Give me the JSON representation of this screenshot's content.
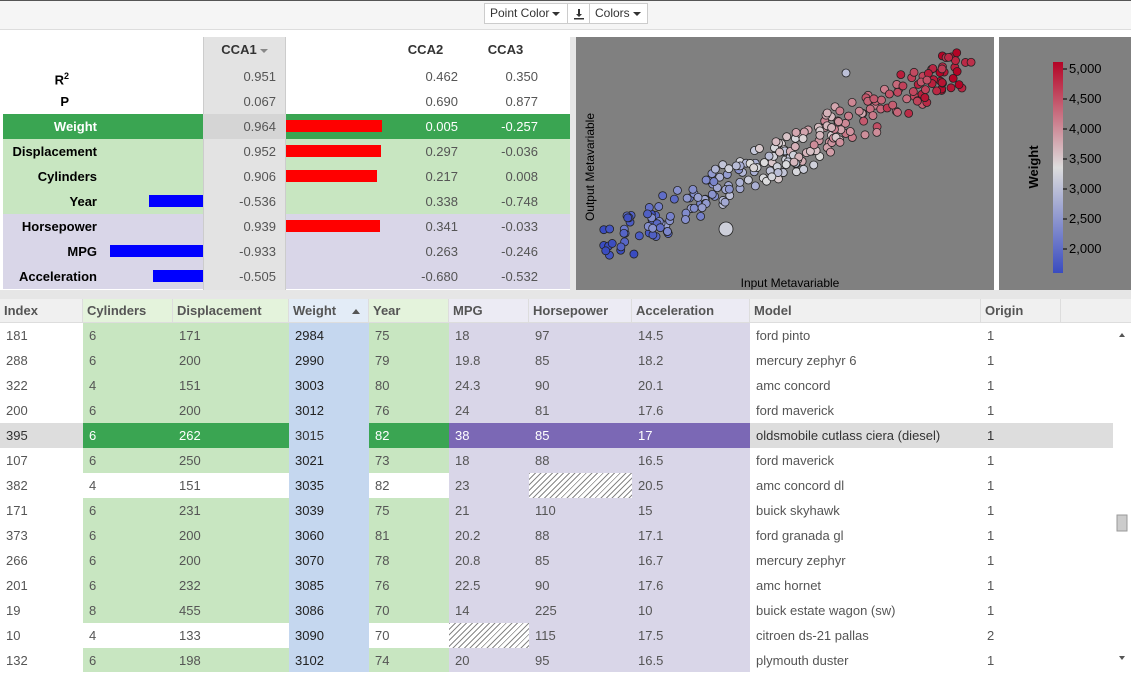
{
  "toolbar": {
    "point_color_label": "Point Color",
    "colors_label": "Colors",
    "download_icon": "download-icon"
  },
  "cca": {
    "headers": [
      "CCA1",
      "CCA2",
      "CCA3"
    ],
    "stats": [
      {
        "label": "R",
        "sup": "2",
        "values": [
          "0.951",
          "0.462",
          "0.350"
        ]
      },
      {
        "label": "P",
        "sup": "",
        "values": [
          "0.067",
          "0.690",
          "0.877"
        ]
      }
    ],
    "rows": [
      {
        "label": "Weight",
        "group": "output",
        "selected": true,
        "loading": 0.964,
        "values": [
          "0.964",
          "0.005",
          "-0.257"
        ]
      },
      {
        "label": "Displacement",
        "group": "input",
        "selected": false,
        "loading": 0.952,
        "values": [
          "0.952",
          "0.297",
          "-0.036"
        ]
      },
      {
        "label": "Cylinders",
        "group": "input",
        "selected": false,
        "loading": 0.906,
        "values": [
          "0.906",
          "0.217",
          "0.008"
        ]
      },
      {
        "label": "Year",
        "group": "input",
        "selected": false,
        "loading": -0.536,
        "values": [
          "-0.536",
          "0.338",
          "-0.748"
        ]
      },
      {
        "label": "Horsepower",
        "group": "output",
        "selected": false,
        "loading": 0.939,
        "values": [
          "0.939",
          "0.341",
          "-0.033"
        ]
      },
      {
        "label": "MPG",
        "group": "output",
        "selected": false,
        "loading": -0.933,
        "values": [
          "-0.933",
          "0.263",
          "-0.246"
        ]
      },
      {
        "label": "Acceleration",
        "group": "output",
        "selected": false,
        "loading": -0.505,
        "values": [
          "-0.505",
          "-0.680",
          "-0.532"
        ]
      }
    ],
    "colors": {
      "selected": "#3aa552",
      "input": "#c8e6c1",
      "output": "#d9d6e8",
      "positive": "#ff0000",
      "negative": "#0000ff",
      "active_col": "#e3e3e3"
    }
  },
  "scatter": {
    "xlabel": "Input Metavariable",
    "ylabel": "Output Metavariable"
  },
  "legend": {
    "title": "Weight",
    "ticks": [
      "5,000",
      "4,500",
      "4,000",
      "3,500",
      "3,000",
      "2,500",
      "2,000"
    ],
    "low_color": "#3a4cc0",
    "mid_color": "#dddddd",
    "high_color": "#b40426"
  },
  "table": {
    "columns": [
      "Index",
      "Cylinders",
      "Displacement",
      "Weight",
      "Year",
      "MPG",
      "Horsepower",
      "Acceleration",
      "Model",
      "Origin"
    ],
    "sort_column": "Weight",
    "rows": [
      {
        "cells": [
          "181",
          "6",
          "171",
          "2984",
          "75",
          "18",
          "97",
          "14.5",
          "ford pinto",
          "1"
        ],
        "hl": false
      },
      {
        "cells": [
          "288",
          "6",
          "200",
          "2990",
          "79",
          "19.8",
          "85",
          "18.2",
          "mercury zephyr 6",
          "1"
        ],
        "hl": false
      },
      {
        "cells": [
          "322",
          "4",
          "151",
          "3003",
          "80",
          "24.3",
          "90",
          "20.1",
          "amc concord",
          "1"
        ],
        "hl": false
      },
      {
        "cells": [
          "200",
          "6",
          "200",
          "3012",
          "76",
          "24",
          "81",
          "17.6",
          "ford maverick",
          "1"
        ],
        "hl": false
      },
      {
        "cells": [
          "395",
          "6",
          "262",
          "3015",
          "82",
          "38",
          "85",
          "17",
          "oldsmobile cutlass ciera (diesel)",
          "1"
        ],
        "hl": true
      },
      {
        "cells": [
          "107",
          "6",
          "250",
          "3021",
          "73",
          "18",
          "88",
          "16.5",
          "ford maverick",
          "1"
        ],
        "hl": false
      },
      {
        "cells": [
          "382",
          "4",
          "151",
          "3035",
          "82",
          "23",
          "",
          "20.5",
          "amc concord dl",
          "1"
        ],
        "hl": false,
        "blank": true
      },
      {
        "cells": [
          "171",
          "6",
          "231",
          "3039",
          "75",
          "21",
          "110",
          "15",
          "buick skyhawk",
          "1"
        ],
        "hl": false
      },
      {
        "cells": [
          "373",
          "6",
          "200",
          "3060",
          "81",
          "20.2",
          "88",
          "17.1",
          "ford granada gl",
          "1"
        ],
        "hl": false
      },
      {
        "cells": [
          "266",
          "6",
          "200",
          "3070",
          "78",
          "20.8",
          "85",
          "16.7",
          "mercury zephyr",
          "1"
        ],
        "hl": false
      },
      {
        "cells": [
          "201",
          "6",
          "232",
          "3085",
          "76",
          "22.5",
          "90",
          "17.6",
          "amc hornet",
          "1"
        ],
        "hl": false
      },
      {
        "cells": [
          "19",
          "8",
          "455",
          "3086",
          "70",
          "14",
          "225",
          "10",
          "buick estate wagon (sw)",
          "1"
        ],
        "hl": false
      },
      {
        "cells": [
          "10",
          "4",
          "133",
          "3090",
          "70",
          "",
          "115",
          "17.5",
          "citroen ds-21 pallas",
          "2"
        ],
        "hl": false,
        "blank": true
      },
      {
        "cells": [
          "132",
          "6",
          "198",
          "3102",
          "74",
          "20",
          "95",
          "16.5",
          "plymouth duster",
          "1"
        ],
        "hl": false
      }
    ]
  }
}
